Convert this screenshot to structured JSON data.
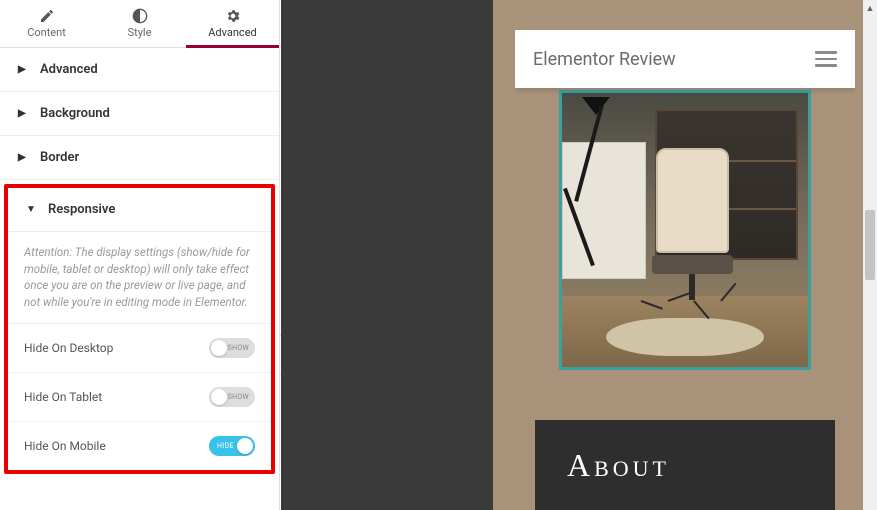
{
  "tabs": {
    "content": "Content",
    "style": "Style",
    "advanced": "Advanced"
  },
  "sections": {
    "advanced": "Advanced",
    "background": "Background",
    "border": "Border",
    "responsive": "Responsive"
  },
  "responsive": {
    "attention": "Attention: The display settings (show/hide for mobile, tablet or desktop) will only take effect once you are on the preview or live page, and not while you're in editing mode in Elementor.",
    "hide_desktop": "Hide On Desktop",
    "hide_tablet": "Hide On Tablet",
    "hide_mobile": "Hide On Mobile",
    "show_label": "SHOW",
    "hide_label": "HIDE"
  },
  "preview": {
    "site_title": "Elementor Review",
    "about_heading": "About"
  }
}
